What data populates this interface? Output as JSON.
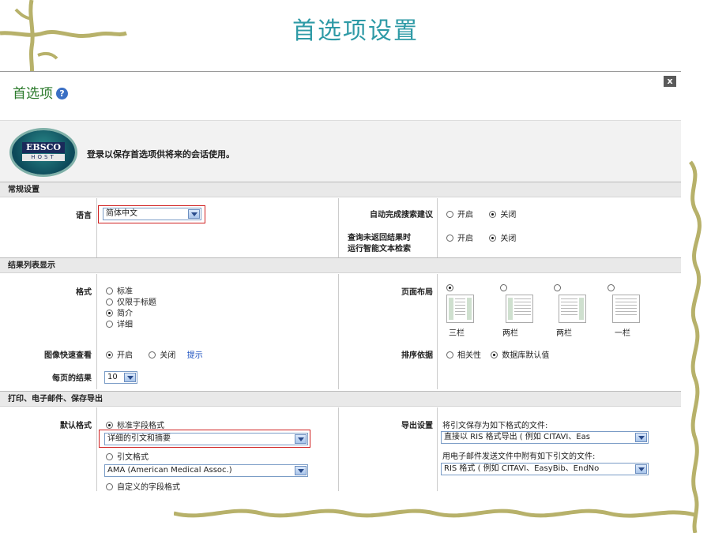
{
  "slide_title": "首选项设置",
  "dialog": {
    "title": "首选项",
    "close": "x",
    "login_message": "登录以保存首选项供将来的会话使用。",
    "logo_top": "EBSCO",
    "logo_bottom": "HOST"
  },
  "general": {
    "header": "常规设置",
    "language_label": "语言",
    "language_value": "简体中文",
    "autocomplete_label": "自动完成搜索建议",
    "autocomplete_on": "开启",
    "autocomplete_off": "关闭",
    "smarttext_label_1": "查询未返回结果时",
    "smarttext_label_2": "运行智能文本检索",
    "smarttext_on": "开启",
    "smarttext_off": "关闭"
  },
  "results": {
    "header": "结果列表显示",
    "format_label": "格式",
    "format_options": [
      "标准",
      "仅限于标题",
      "简介",
      "详细"
    ],
    "format_selected": 2,
    "layout_label": "页面布局",
    "layout_options": [
      "三栏",
      "两栏",
      "两栏",
      "一栏"
    ],
    "layout_selected": 0,
    "quickview_label": "图像快速查看",
    "quickview_on": "开启",
    "quickview_off": "关闭",
    "quickview_hint": "提示",
    "sort_label": "排序依据",
    "sort_relevance": "相关性",
    "sort_default": "数据库默认值",
    "per_page_label": "每页的结果",
    "per_page_value": "10"
  },
  "export": {
    "header": "打印、电子邮件、保存导出",
    "default_format_label": "默认格式",
    "standard_fields": "标准字段格式",
    "standard_fields_value": "详细的引文和摘要",
    "citation_format": "引文格式",
    "citation_value": "AMA (American Medical Assoc.)",
    "custom_fields": "自定义的字段格式",
    "export_label": "导出设置",
    "export_save_text": "将引文保存为如下格式的文件:",
    "export_save_value": "直接以 RIS 格式导出 ( 例如 CITAVI、Eas",
    "export_email_text": "用电子邮件发送文件中附有如下引文的文件:",
    "export_email_value": "RIS 格式 ( 例如 CITAVI、EasyBib、EndNo"
  },
  "colors": {
    "title": "#2e9aa6",
    "dialog_title": "#2b7a2b",
    "highlight": "#d02020",
    "vine": "#b7b16a"
  }
}
